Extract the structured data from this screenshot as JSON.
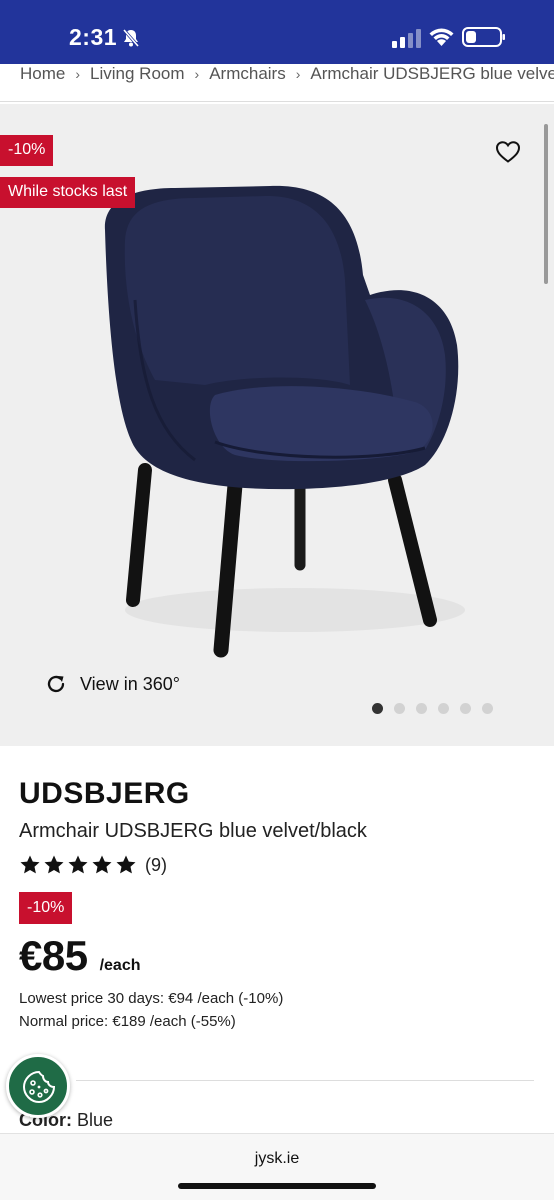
{
  "status_bar": {
    "time": "2:31"
  },
  "breadcrumb": [
    "Home",
    "Living Room",
    "Armchairs",
    "Armchair UDSBJERG blue velvet"
  ],
  "gallery": {
    "discount_badge": "-10%",
    "stock_badge": "While stocks last",
    "view360_label": "View in 360°",
    "slide_count": 6,
    "active_slide": 1
  },
  "product": {
    "brand": "UDSBJERG",
    "name": "Armchair UDSBJERG blue velvet/black",
    "rating": 5,
    "review_count": "(9)",
    "discount_badge": "-10%",
    "price": "€85",
    "unit": "/each",
    "lowest_price": "Lowest price 30 days: €94 /each (-10%)",
    "normal_price": "Normal price: €189 /each (-55%)",
    "color_label": "Color:",
    "color_value": "Blue"
  },
  "browser": {
    "domain": "jysk.ie"
  },
  "colors": {
    "brand_blue": "#22349b",
    "badge_red": "#c8102e",
    "cookie_green": "#1f6b46"
  }
}
